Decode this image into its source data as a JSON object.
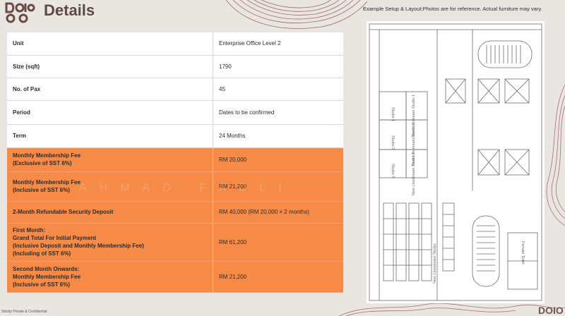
{
  "header": {
    "title": "Details",
    "caption": "Example Setup & Layout:Photos are for reference. Actual furniture may vary."
  },
  "rows": [
    {
      "label_lines": [
        "Unit"
      ],
      "value": "Enterprise Office Level 2",
      "style": "white"
    },
    {
      "label_lines": [
        "Size (sqft)"
      ],
      "value": "1790",
      "style": "white"
    },
    {
      "label_lines": [
        "No. of Pax"
      ],
      "value": "45",
      "style": "white"
    },
    {
      "label_lines": [
        "Period"
      ],
      "value": "Dates to be confirmed",
      "style": "white"
    },
    {
      "label_lines": [
        "Term"
      ],
      "value": "24 Months",
      "style": "white"
    },
    {
      "label_lines": [
        "Monthly Membership Fee",
        "(Exclusive of SST 6%)"
      ],
      "value": "RM 20,000",
      "style": "orange"
    },
    {
      "label_lines": [
        "Monthly Membership Fee",
        "(Inclusive of SST 6%)"
      ],
      "value": "RM 21,200",
      "style": "orange"
    },
    {
      "label_lines": [
        "2-Month Refundable Security Deposit"
      ],
      "value": "RM 40,000 (RM 20,000 × 2 months)",
      "style": "orange"
    },
    {
      "label_lines": [
        "First Month:",
        "Grand Total For Initial Payment",
        "(Inclusive Deposit and Monthly Membership Fee)",
        "(Including of SST 6%)"
      ],
      "value": "RM 61,200",
      "style": "orange"
    },
    {
      "label_lines": [
        "Second Month Onwards:",
        "Monthly Membership Fee",
        "(Inclusive of SST 6%)"
      ],
      "value": "RM 21,200",
      "style": "orange"
    }
  ],
  "watermark": "AHMAD FADLI",
  "floorplan": {
    "room_labels": [
      "Studio 1",
      "Studio 2",
      "Studio 3"
    ],
    "studio_labels": [
      "New Livestream Studio 1",
      "New Livestream Studio 2",
      "New Livestream Studio 3",
      "New Livestream Studio"
    ],
    "toilet_label": "Female Toilet"
  },
  "footer": "Strictly Private & Confidential",
  "brand_corner": "DOIO",
  "colors": {
    "accent_orange": "#f68b48",
    "title_brown": "#5e4a43",
    "deco_maroon": "#8e3a4a"
  }
}
